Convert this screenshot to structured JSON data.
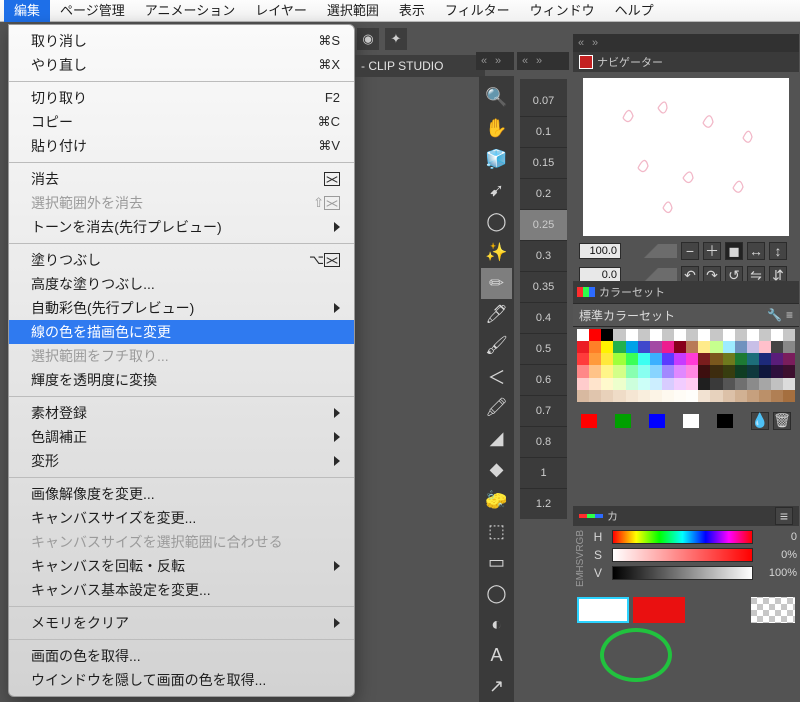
{
  "menubar": {
    "items": [
      "編集",
      "ページ管理",
      "アニメーション",
      "レイヤー",
      "選択範囲",
      "表示",
      "フィルター",
      "ウィンドウ",
      "ヘルプ"
    ]
  },
  "dropdown": {
    "groups": [
      [
        {
          "label": "取り消し",
          "shortcut": "⌘S"
        },
        {
          "label": "やり直し",
          "shortcut": "⌘X"
        }
      ],
      [
        {
          "label": "切り取り",
          "shortcut": "F2"
        },
        {
          "label": "コピー",
          "shortcut": "⌘C"
        },
        {
          "label": "貼り付け",
          "shortcut": "⌘V"
        }
      ],
      [
        {
          "label": "消去",
          "icon": "xbox"
        },
        {
          "label": "選択範囲外を消去",
          "icon": "xbox",
          "disabled": true,
          "shortcut": "⇧"
        },
        {
          "label": "トーンを消去(先行プレビュー)",
          "submenu": true
        }
      ],
      [
        {
          "label": "塗りつぶし",
          "icon": "xbox",
          "shortcut": "⌥"
        },
        {
          "label": "高度な塗りつぶし..."
        },
        {
          "label": "自動彩色(先行プレビュー)",
          "submenu": true
        },
        {
          "label": "線の色を描画色に変更",
          "highlighted": true
        },
        {
          "label": "選択範囲をフチ取り...",
          "disabled": true
        },
        {
          "label": "輝度を透明度に変換"
        }
      ],
      [
        {
          "label": "素材登録",
          "submenu": true
        },
        {
          "label": "色調補正",
          "submenu": true
        },
        {
          "label": "変形",
          "submenu": true
        }
      ],
      [
        {
          "label": "画像解像度を変更..."
        },
        {
          "label": "キャンバスサイズを変更..."
        },
        {
          "label": "キャンバスサイズを選択範囲に合わせる",
          "disabled": true
        },
        {
          "label": "キャンバスを回転・反転",
          "submenu": true
        },
        {
          "label": "キャンバス基本設定を変更..."
        }
      ],
      [
        {
          "label": "メモリをクリア",
          "submenu": true
        }
      ],
      [
        {
          "label": "画面の色を取得..."
        },
        {
          "label": "ウインドウを隠して画面の色を取得..."
        }
      ]
    ]
  },
  "doc_title": "- CLIP STUDIO",
  "sizes": [
    "0.07",
    "0.1",
    "0.15",
    "0.2",
    "0.25",
    "0.3",
    "0.35",
    "0.4",
    "0.5",
    "0.6",
    "0.7",
    "0.8",
    "1",
    "1.2"
  ],
  "size_selected_index": 4,
  "navigator": {
    "title": "ナビゲーター",
    "zoom": "100.0",
    "rotate": "0.0"
  },
  "colorset": {
    "tab_title": "カラーセット",
    "dropdown": "標準カラーセット",
    "rows": [
      [
        "#ffffff",
        "#ff0000",
        "#000000",
        "#c7c7c7",
        "#ffffff",
        "#c7c7c7",
        "#ffffff",
        "#c7c7c7",
        "#ffffff",
        "#c7c7c7",
        "#ffffff",
        "#c7c7c7",
        "#ffffff",
        "#c7c7c7",
        "#ffffff",
        "#c7c7c7",
        "#ffffff",
        "#c7c7c7"
      ],
      [
        "#ec1c24",
        "#ff7f27",
        "#fff200",
        "#22b14c",
        "#00a2e8",
        "#3f48cc",
        "#a349a4",
        "#ed1c8f",
        "#88001b",
        "#b97a57",
        "#ffeb8a",
        "#c6ff8e",
        "#9debff",
        "#7092be",
        "#c8bfe7",
        "#ffc0cb",
        "#444444",
        "#888888"
      ],
      [
        "#ff3b3b",
        "#ff9a3b",
        "#ffe93b",
        "#9fff3b",
        "#3bff57",
        "#3bfff1",
        "#3bb0ff",
        "#5a3bff",
        "#c63bff",
        "#ff3bd6",
        "#7a1d1d",
        "#7a571d",
        "#6e7a1d",
        "#1d7a33",
        "#1d6e7a",
        "#1d2a7a",
        "#5a1d7a",
        "#7a1d5c"
      ],
      [
        "#ff8888",
        "#ffc388",
        "#fff588",
        "#d3ff88",
        "#88ffb0",
        "#88fff0",
        "#88d4ff",
        "#a288ff",
        "#e088ff",
        "#ff88e2",
        "#3d0f0f",
        "#3d2c0f",
        "#373d0f",
        "#0f3d23",
        "#0f383d",
        "#0f173d",
        "#2e0f3d",
        "#3d0f2f"
      ],
      [
        "#ffcccc",
        "#ffe4cc",
        "#fff9cc",
        "#edffcc",
        "#ccffdc",
        "#ccfff8",
        "#cceeff",
        "#d8ccff",
        "#f2ccff",
        "#ffccf2",
        "#1f1f1f",
        "#3a3a3a",
        "#555555",
        "#707070",
        "#8b8b8b",
        "#a6a6a6",
        "#c1c1c1",
        "#dcdcdc"
      ],
      [
        "#d8b9a0",
        "#e0c5ad",
        "#e8d1ba",
        "#efdcc7",
        "#f5e6d3",
        "#f9eedd",
        "#fcf4e6",
        "#fef9ef",
        "#fffcf6",
        "#fffefb",
        "#f2e2d2",
        "#e7d2bd",
        "#dcc1a8",
        "#d1b193",
        "#c6a07e",
        "#bb9069",
        "#b07f54",
        "#a56f3f"
      ]
    ],
    "quick_colors": [
      "#ff0000",
      "#00a000",
      "#0000ff",
      "#ffffff",
      "#000000"
    ]
  },
  "hsv": {
    "tab_title": "カ",
    "rows": [
      {
        "letter": "H",
        "gradient": "linear-gradient(90deg,#ff0000,#ffff00,#00ff00,#00ffff,#0000ff,#ff00ff,#ff0000)",
        "value": "0"
      },
      {
        "letter": "S",
        "gradient": "linear-gradient(90deg,#ffffff,#ff0000)",
        "value": "0%"
      },
      {
        "letter": "V",
        "gradient": "linear-gradient(90deg,#000000,#ffffff)",
        "value": "100%"
      }
    ],
    "mode_labels": [
      "RGB",
      "HSV",
      "EM"
    ]
  }
}
